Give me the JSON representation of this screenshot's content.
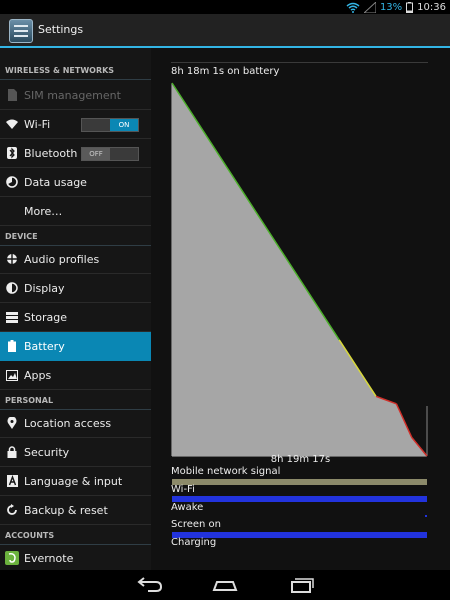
{
  "status": {
    "battery_percent": "13%",
    "time": "10:36"
  },
  "actionbar": {
    "title": "Settings"
  },
  "sections": {
    "wireless": "WIRELESS & NETWORKS",
    "device": "DEVICE",
    "personal": "PERSONAL",
    "accounts": "ACCOUNTS"
  },
  "items": {
    "sim": "SIM management",
    "wifi": "Wi-Fi",
    "wifi_toggle": "ON",
    "bluetooth": "Bluetooth",
    "bluetooth_toggle": "OFF",
    "data_usage": "Data usage",
    "more": "More…",
    "audio": "Audio profiles",
    "display": "Display",
    "storage": "Storage",
    "battery": "Battery",
    "apps": "Apps",
    "location": "Location access",
    "security": "Security",
    "language": "Language & input",
    "backup": "Backup & reset",
    "evernote": "Evernote"
  },
  "battery_panel": {
    "on_battery": "8h 18m 1s on battery",
    "time_label": "8h 19m 17s",
    "signals": {
      "mobile": "Mobile network signal",
      "wifi": "Wi-Fi",
      "awake": "Awake",
      "screen": "Screen on",
      "charging": "Charging"
    }
  },
  "chart_data": {
    "type": "area",
    "title": "",
    "xlabel": "",
    "ylabel": "",
    "ylim": [
      0,
      100
    ],
    "x": [
      0,
      0.8,
      0.88,
      0.94,
      1.0
    ],
    "y": [
      100,
      16,
      14,
      5,
      0
    ],
    "colors": {
      "fill": "#a6a6a6",
      "ok": "#4caf2b",
      "mid": "#d8d83a",
      "low": "#d0302a"
    }
  }
}
